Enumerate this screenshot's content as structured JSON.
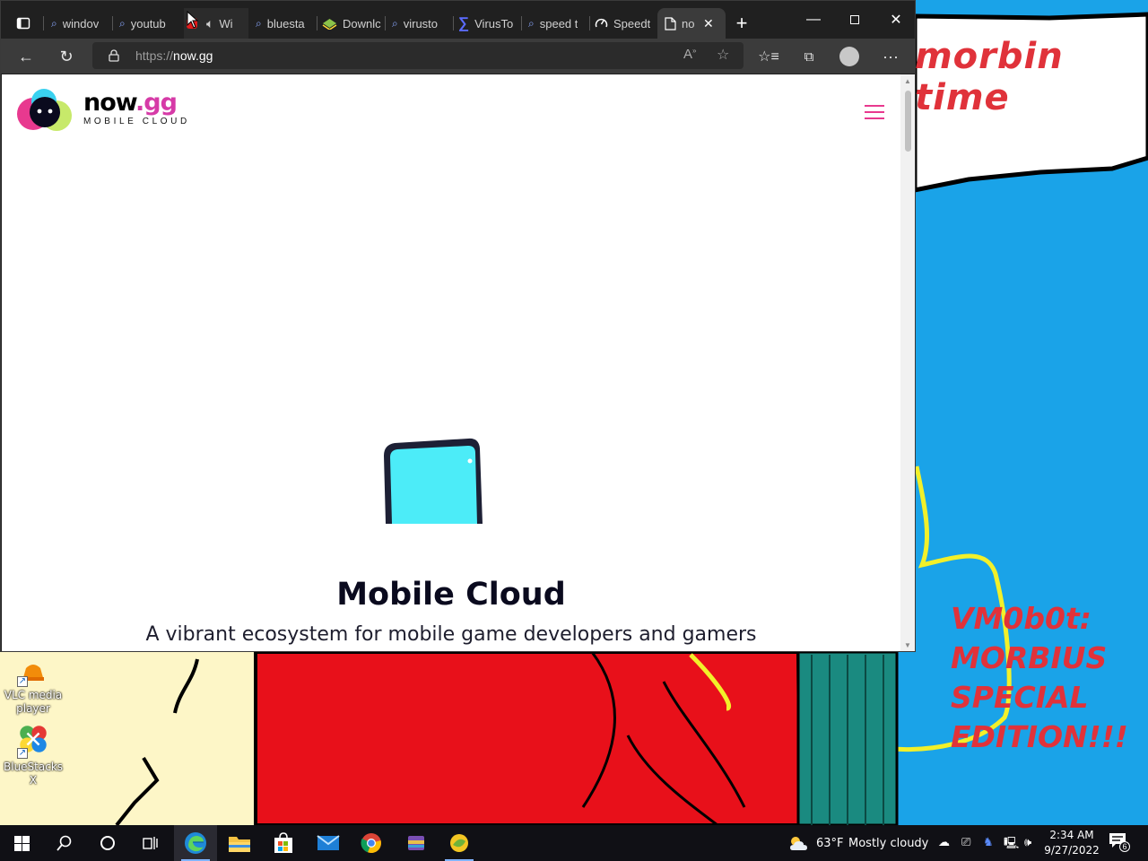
{
  "desktop": {
    "banner_text": "morbin time",
    "edition_text": [
      "VM0b0t:",
      "MORBIUS",
      "SPECIAL",
      "EDITION!!!"
    ],
    "icons": [
      {
        "label_line1": "VLC media",
        "label_line2": "player",
        "icon": "vlc-icon"
      },
      {
        "label_line1": "BlueStacks X",
        "label_line2": "",
        "icon": "bluestacks-x-icon"
      }
    ]
  },
  "browser": {
    "tabs": [
      {
        "label": "windov",
        "icon": "search-icon"
      },
      {
        "label": "youtub",
        "icon": "search-icon"
      },
      {
        "label": "Wi",
        "icon": "speaker-icon"
      },
      {
        "label": "bluesta",
        "icon": "search-icon"
      },
      {
        "label": "Downlc",
        "icon": "bluestacks-icon"
      },
      {
        "label": "virusto",
        "icon": "search-icon"
      },
      {
        "label": "VirusTo",
        "icon": "virustotal-icon"
      },
      {
        "label": "speed t",
        "icon": "search-icon"
      },
      {
        "label": "Speedt",
        "icon": "speedtest-icon"
      },
      {
        "label": "no",
        "icon": "page-icon",
        "active": true
      }
    ],
    "url_prefix": "https://",
    "url_host": "now.gg",
    "colors": {
      "tab_bar": "#202020",
      "toolbar": "#3b3b3b",
      "accent_pink": "#e8398f"
    }
  },
  "page": {
    "logo_main": "now",
    "logo_suffix": ".gg",
    "logo_sub": "MOBILE CLOUD",
    "hero_title": "Mobile Cloud",
    "hero_subtitle": "A vibrant ecosystem for mobile game developers and gamers"
  },
  "taskbar": {
    "weather_temp": "63°F",
    "weather_desc": "Mostly cloudy",
    "time": "2:34 AM",
    "date": "9/27/2022",
    "notifications_count": "6",
    "pinned": [
      "start-icon",
      "search-icon",
      "cortana-icon",
      "task-view-icon",
      "edge-icon",
      "file-explorer-icon",
      "store-icon",
      "mail-icon",
      "chrome-icon",
      "winrar-icon",
      "bluestacks-icon"
    ]
  }
}
